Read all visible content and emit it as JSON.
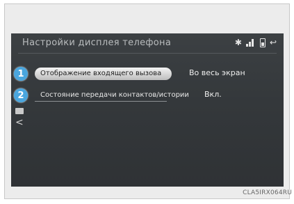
{
  "screen": {
    "title": "Настройки дисплея телефона",
    "status_icons": [
      "bluetooth-icon",
      "signal-icon",
      "battery-icon",
      "back-icon"
    ]
  },
  "items": [
    {
      "number": "1",
      "label": "Отображение входящего вызова",
      "value": "Во весь экран"
    },
    {
      "number": "2",
      "label": "Состояние передачи контактов/истории",
      "value": "Вкл."
    }
  ],
  "side": {
    "icons": [
      "list-icon",
      "chevron-left-icon"
    ]
  },
  "caption": "CLA5IRX064RU",
  "colors": {
    "screen_bg": "#34383b",
    "badge": "#4aa6de",
    "selected_button": "#e2e2e2"
  }
}
